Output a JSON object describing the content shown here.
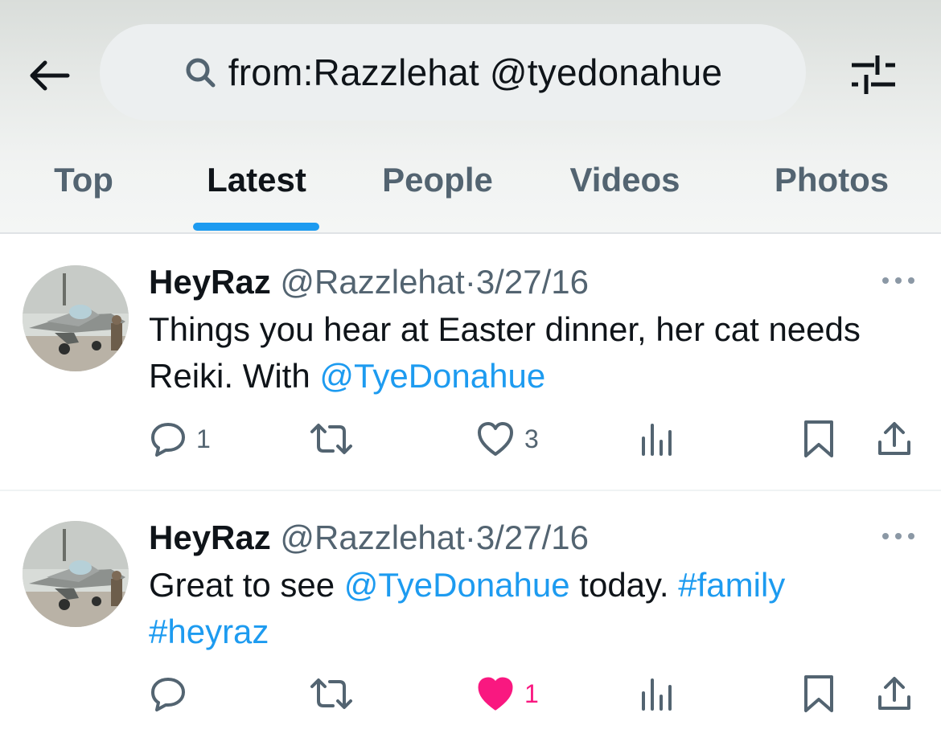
{
  "search": {
    "query": "from:Razzlehat @tyedonahue",
    "icon": "search-icon"
  },
  "tabs": [
    {
      "label": "Top",
      "active": false
    },
    {
      "label": "Latest",
      "active": true
    },
    {
      "label": "People",
      "active": false
    },
    {
      "label": "Videos",
      "active": false
    },
    {
      "label": "Photos",
      "active": false
    }
  ],
  "colors": {
    "accent": "#1d9bf0",
    "like_active": "#f91880",
    "secondary_text": "#536471"
  },
  "tweets": [
    {
      "name": "HeyRaz",
      "handle": "@Razzlehat",
      "dot": "·",
      "date": "3/27/16",
      "text_parts": [
        {
          "text": "Things you hear at Easter dinner, her cat needs Reiki. With ",
          "link": false
        },
        {
          "text": "@TyeDonahue",
          "link": true
        }
      ],
      "replies": "1",
      "retweets": "",
      "likes": "3",
      "liked": false,
      "views": ""
    },
    {
      "name": "HeyRaz",
      "handle": "@Razzlehat",
      "dot": "·",
      "date": "3/27/16",
      "text_parts": [
        {
          "text": "Great to see ",
          "link": false
        },
        {
          "text": "@TyeDonahue",
          "link": true
        },
        {
          "text": " today. ",
          "link": false
        },
        {
          "text": "#family",
          "link": true
        },
        {
          "text": " ",
          "link": false
        },
        {
          "text": "#heyraz",
          "link": true
        }
      ],
      "replies": "",
      "retweets": "",
      "likes": "1",
      "liked": true,
      "views": ""
    }
  ]
}
